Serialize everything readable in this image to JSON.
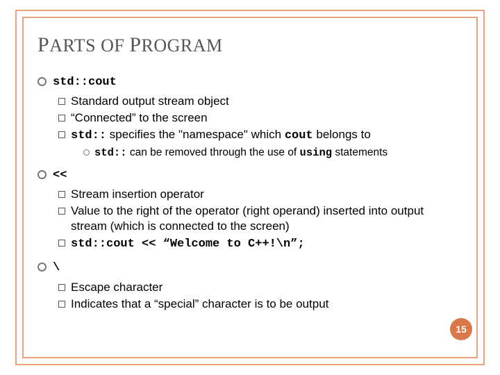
{
  "title": "Parts of Program",
  "sections": [
    {
      "head_code": "std::cout",
      "items": [
        {
          "text": "Standard output stream object"
        },
        {
          "text": "“Connected” to the screen"
        },
        {
          "html": "<span class='code'>std::</span> specifies the \"namespace\" which <span class='code'>cout</span> belongs to",
          "sub": [
            {
              "html": "<span class='code'>std::</span> can be removed through the use of <span class='code'>using</span> statements"
            }
          ]
        }
      ]
    },
    {
      "head_code": "<<",
      "items": [
        {
          "text": "Stream insertion operator"
        },
        {
          "text": "Value to the right of the operator (right operand) inserted into output stream (which is connected to the screen)"
        },
        {
          "html": "<span class='code'>std::cout &lt;&lt; “Welcome to C++!\\n”;</span>"
        }
      ]
    },
    {
      "head_code": "\\",
      "items": [
        {
          "text": "Escape character"
        },
        {
          "text": "Indicates that a “special” character is to be output"
        }
      ]
    }
  ],
  "page_number": "15"
}
